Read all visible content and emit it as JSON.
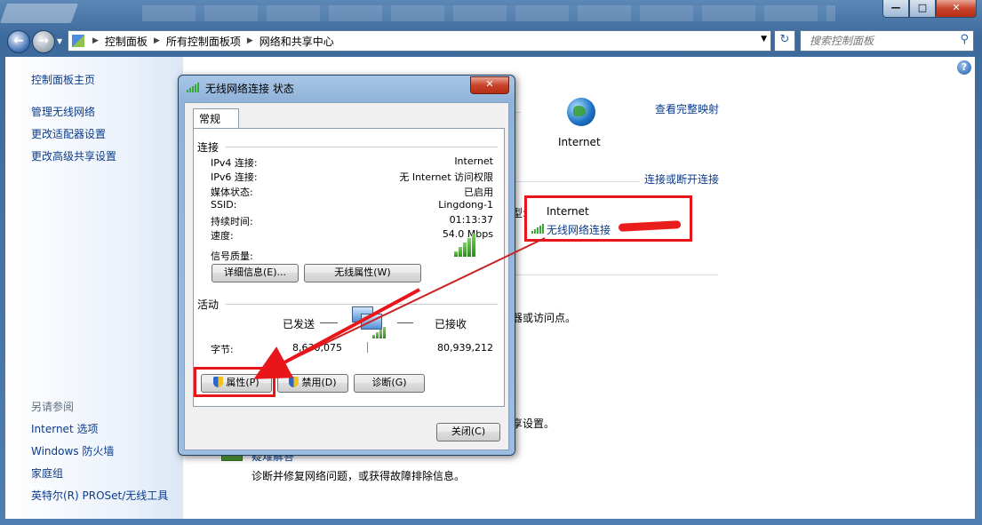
{
  "window": {
    "caption_buttons": {
      "minimize": "—",
      "maximize": "□",
      "close": "✕"
    }
  },
  "nav": {
    "back_glyph": "←",
    "forward_glyph": "→",
    "breadcrumbs": [
      "控制面板",
      "所有控制面板项",
      "网络和共享中心"
    ],
    "refresh_glyph": "↻",
    "search_placeholder": "搜索控制面板",
    "search_glyph": "⚲"
  },
  "sidebar": {
    "home": "控制面板主页",
    "links": [
      "管理无线网络",
      "更改适配器设置",
      "更改高级共享设置"
    ],
    "see_also_title": "另请参阅",
    "see_also": [
      "Internet 选项",
      "Windows 防火墙",
      "家庭组",
      "英特尔(R) PROSet/无线工具"
    ]
  },
  "main": {
    "help_glyph": "?",
    "internet_label": "Internet",
    "view_full_map": "查看完整映射",
    "connect_disconnect": "连接或断开连接",
    "access_type_suffix": "型:",
    "access_type_value": "Internet",
    "connection_link": "无线网络连接",
    "fragment_router": "器或访问点。",
    "fragment_2": "。",
    "fragment_settings": "享设置。",
    "troubleshoot_title": "疑难解答",
    "troubleshoot_desc": "诊断并修复网络问题，或获得故障排除信息。"
  },
  "dialog": {
    "title": "无线网络连接 状态",
    "close_glyph": "✕",
    "tab_general": "常规",
    "connection_group": "连接",
    "rows": [
      {
        "label": "IPv4 连接:",
        "value": "Internet"
      },
      {
        "label": "IPv6 连接:",
        "value": "无 Internet 访问权限"
      },
      {
        "label": "媒体状态:",
        "value": "已启用"
      },
      {
        "label": "SSID:",
        "value": "Lingdong-1"
      },
      {
        "label": "持续时间:",
        "value": "01:13:37"
      },
      {
        "label": "速度:",
        "value": "54.0 Mbps"
      }
    ],
    "signal_quality": "信号质量:",
    "signal_bars": 5,
    "details_button": "详细信息(E)...",
    "wireless_props_button": "无线属性(W)",
    "activity_group": "活动",
    "sent_label": "已发送",
    "received_label": "已接收",
    "bytes_label": "字节:",
    "bytes_sent": "8,630,075",
    "bytes_received": "80,939,212",
    "properties_button": "属性(P)",
    "disable_button": "禁用(D)",
    "diagnose_button": "诊断(G)",
    "close_button": "关闭(C)"
  },
  "colors": {
    "link": "#0b3b8c",
    "highlight_red": "#e8161b",
    "signal_green": "#3aa637"
  }
}
